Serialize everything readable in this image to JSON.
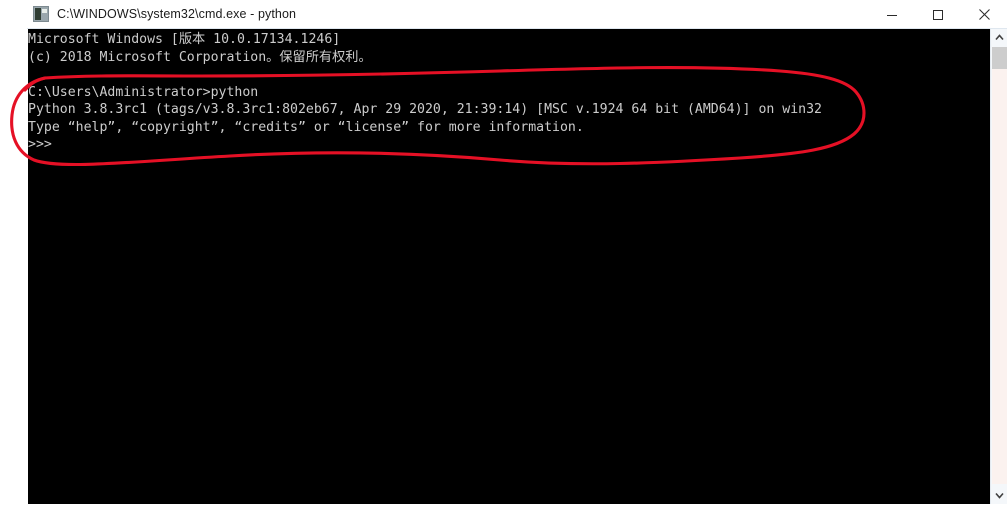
{
  "window": {
    "title": "C:\\WINDOWS\\system32\\cmd.exe - python",
    "icon": "cmd-exe-icon",
    "controls": {
      "minimize_label": "Minimize",
      "maximize_label": "Maximize",
      "close_label": "Close"
    }
  },
  "console": {
    "background_color": "#000000",
    "text_color": "#cccccc",
    "lines": [
      "Microsoft Windows [版本 10.0.17134.1246]",
      "(c) 2018 Microsoft Corporation。保留所有权利。",
      "",
      "C:\\Users\\Administrator>python",
      "Python 3.8.3rc1 (tags/v3.8.3rc1:802eb67, Apr 29 2020, 21:39:14) [MSC v.1924 64 bit (AMD64)] on win32",
      "Type “help”, “copyright”, “credits” or “license” for more information.",
      ">>>"
    ]
  },
  "scrollbar": {
    "up_arrow": "chevron-up-icon",
    "down_arrow": "chevron-down-icon"
  },
  "annotation": {
    "type": "hand-drawn-ellipse",
    "color": "#e51025",
    "stroke_width": 3,
    "description": "Red circled highlight around the python launch and interpreter banner lines"
  }
}
